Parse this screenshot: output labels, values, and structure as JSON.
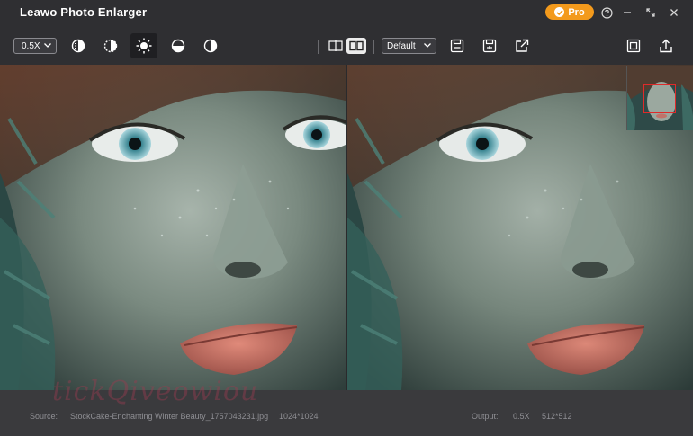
{
  "app": {
    "title": "Leawo Photo Enlarger",
    "pro_label": "Pro"
  },
  "toolbar": {
    "zoom_value": "0.5X",
    "model_value": "Default",
    "icons": [
      "brightness-half-icon",
      "contrast-icon",
      "sun-icon",
      "half-circle-icon",
      "contrast-alt-icon",
      "split-view-icon",
      "side-by-side-icon",
      "save-icon",
      "save-as-icon",
      "export-icon",
      "fit-icon",
      "share-icon"
    ]
  },
  "status": {
    "source_label": "Source:",
    "source_file": "StockCake-Enchanting Winter Beauty_1757043231.jpg",
    "source_size": "1024*1024",
    "output_label": "Output:",
    "output_zoom": "0.5X",
    "output_size": "512*512"
  },
  "watermark_text": "tickQiveowiou",
  "colors": {
    "accent_pro": "#f39a1c",
    "navigator_frame": "#e02a2a",
    "background": "#3a3a3d",
    "toolbar": "#2f2f32"
  }
}
